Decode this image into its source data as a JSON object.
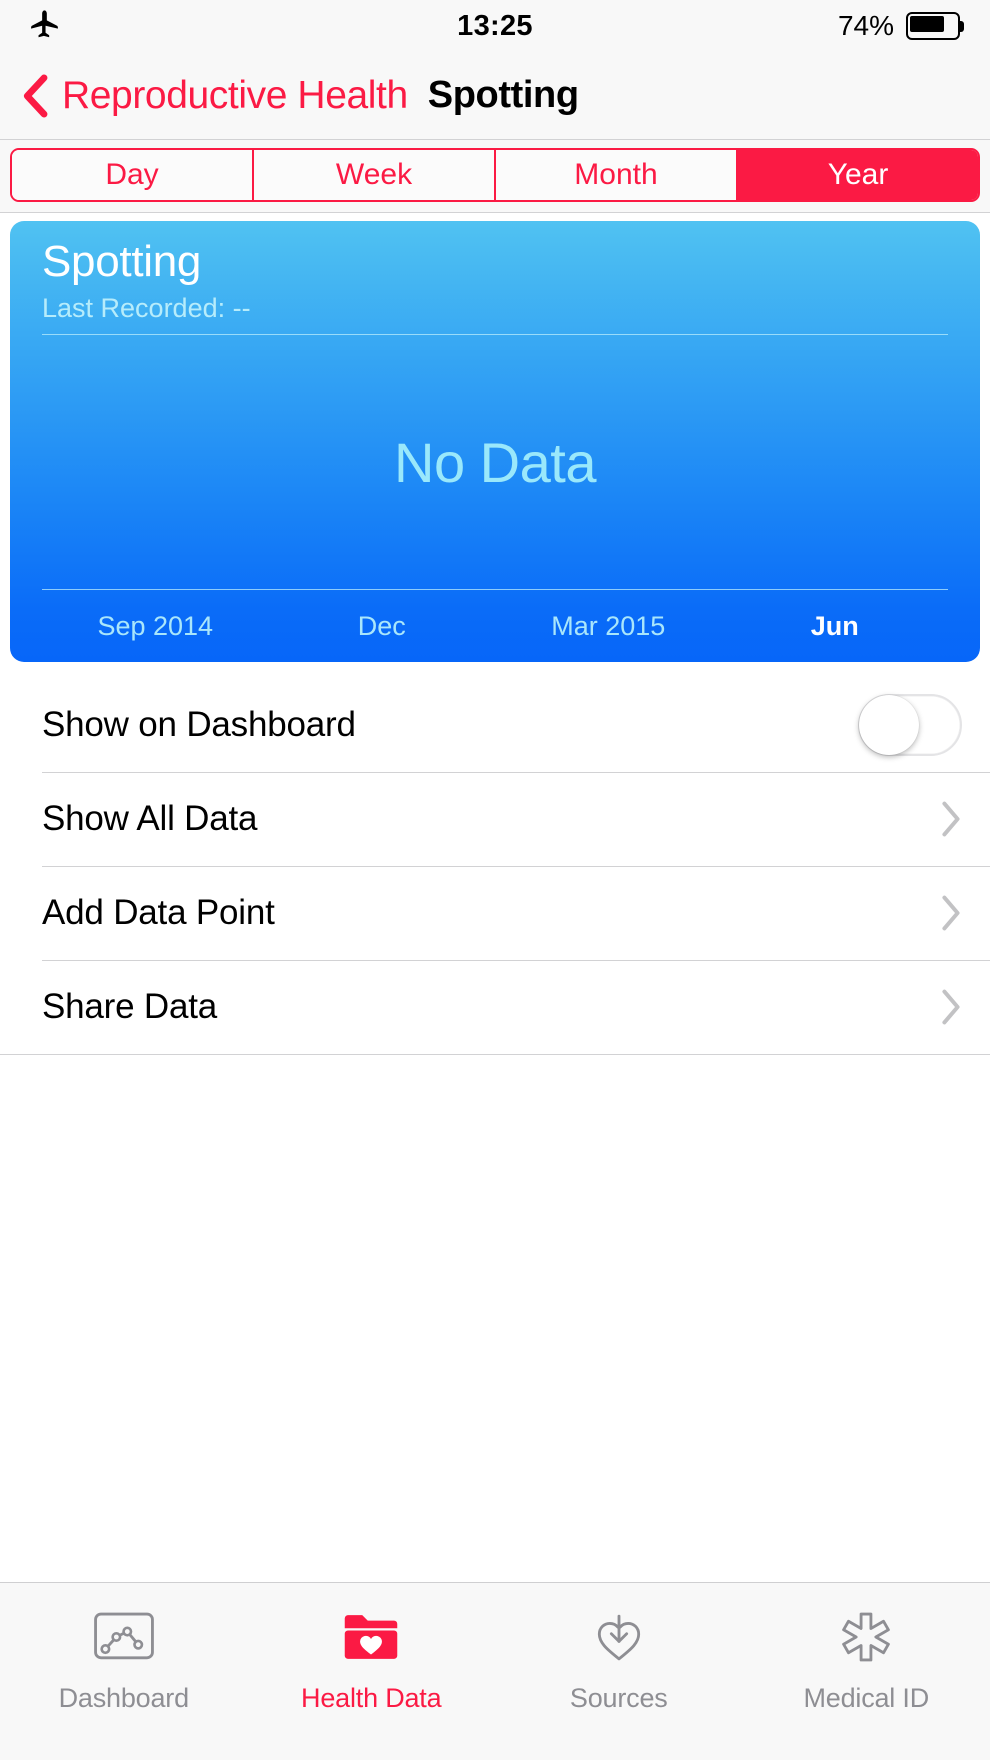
{
  "status_bar": {
    "airplane_icon": "airplane-mode-icon",
    "time": "13:25",
    "battery_percent": "74%",
    "battery_level": 74
  },
  "nav_bar": {
    "back_icon": "chevron-left-icon",
    "back_label": "Reproductive Health",
    "title": "Spotting"
  },
  "segmented_control": {
    "options": [
      {
        "label": "Day",
        "selected": false
      },
      {
        "label": "Week",
        "selected": false
      },
      {
        "label": "Month",
        "selected": false
      },
      {
        "label": "Year",
        "selected": true
      }
    ],
    "selected": "Year",
    "tint": "#fb1a44"
  },
  "chart_card": {
    "title": "Spotting",
    "subtitle": "Last Recorded: --",
    "empty_message": "No Data",
    "gradient_top": "#50c2f2",
    "gradient_bottom": "#0766f9",
    "label_color": "#a9e6fb",
    "empty_color": "#9ae8fb"
  },
  "chart_data": {
    "type": "bar",
    "title": "Spotting",
    "subtitle": "Last Recorded: --",
    "range": "Year",
    "xlabel": "",
    "ylabel": "",
    "categories": [
      "Sep 2014",
      "Dec",
      "Mar 2015",
      "Jun"
    ],
    "values": [
      null,
      null,
      null,
      null
    ],
    "series": [
      {
        "name": "Spotting",
        "values": []
      }
    ],
    "tick_labels": [
      "Sep 2014",
      "Dec",
      "Mar 2015",
      "Jun"
    ],
    "current_tick": "Jun",
    "grid": false,
    "legend": false,
    "empty": true,
    "empty_message": "No Data"
  },
  "list": {
    "rows": [
      {
        "label": "Show on Dashboard",
        "accessory": "toggle",
        "toggle_on": false
      },
      {
        "label": "Show All Data",
        "accessory": "chevron"
      },
      {
        "label": "Add Data Point",
        "accessory": "chevron"
      },
      {
        "label": "Share Data",
        "accessory": "chevron"
      }
    ]
  },
  "tab_bar": {
    "tabs": [
      {
        "label": "Dashboard",
        "icon": "dashboard-chart-icon",
        "active": false
      },
      {
        "label": "Health Data",
        "icon": "health-data-folder-heart-icon",
        "active": true
      },
      {
        "label": "Sources",
        "icon": "sources-heart-download-icon",
        "active": false
      },
      {
        "label": "Medical ID",
        "icon": "medical-id-star-of-life-icon",
        "active": false
      }
    ],
    "active_color": "#fb1a44",
    "inactive_color": "#8e8e93"
  }
}
